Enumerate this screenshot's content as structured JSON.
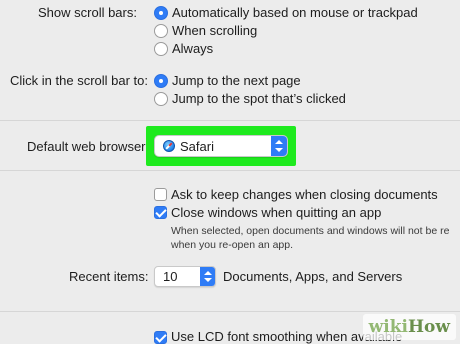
{
  "scroll_bars": {
    "label": "Show scroll bars:",
    "options": [
      "Automatically based on mouse or trackpad",
      "When scrolling",
      "Always"
    ],
    "selected_index": 0
  },
  "click_scroll": {
    "label": "Click in the scroll bar to:",
    "options": [
      "Jump to the next page",
      "Jump to the spot that’s clicked"
    ],
    "selected_index": 0
  },
  "default_browser": {
    "label": "Default web browser:",
    "value": "Safari",
    "icon": "safari-icon",
    "highlight_color": "#1eea1e"
  },
  "checkboxes": {
    "ask_keep_changes": {
      "label": "Ask to keep changes when closing documents",
      "checked": false
    },
    "close_windows": {
      "label": "Close windows when quitting an app",
      "checked": true
    },
    "close_windows_note_line1": "When selected, open documents and windows will not be re",
    "close_windows_note_line2": "when you re-open an app."
  },
  "recent_items": {
    "label": "Recent items:",
    "value": "10",
    "suffix": "Documents, Apps, and Servers"
  },
  "lcd_smoothing": {
    "label": "Use LCD font smoothing when available",
    "checked": true
  },
  "watermark": {
    "wiki": "wiki",
    "how": "How"
  },
  "colors": {
    "accent": "#2f7cf6",
    "background": "#ececec"
  }
}
